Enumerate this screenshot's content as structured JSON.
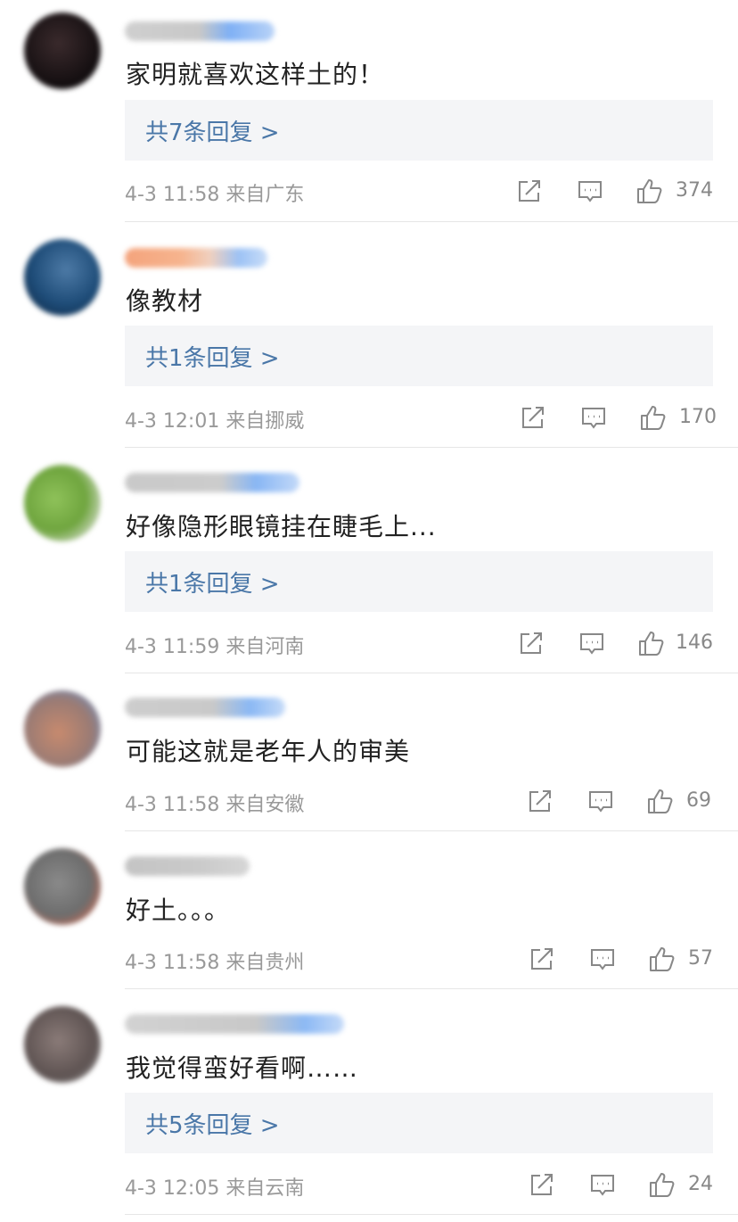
{
  "comments": [
    {
      "text": "家明就喜欢这样土的！",
      "replies": "共7条回复 >",
      "time": "4-3 11:58",
      "location": "来自广东",
      "likes": "374"
    },
    {
      "text": "像教材",
      "replies": "共1条回复 >",
      "time": "4-3 12:01",
      "location": "来自挪威",
      "likes": "170"
    },
    {
      "text": "好像隐形眼镜挂在睫毛上...",
      "replies": "共1条回复 >",
      "time": "4-3 11:59",
      "location": "来自河南",
      "likes": "146"
    },
    {
      "text": "可能这就是老年人的审美",
      "time": "4-3 11:58",
      "location": "来自安徽",
      "likes": "69"
    },
    {
      "text": "好土。。。",
      "time": "4-3 11:58",
      "location": "来自贵州",
      "likes": "57"
    },
    {
      "text": "我觉得蛮好看啊……",
      "replies": "共5条回复 >",
      "time": "4-3 12:05",
      "location": "来自云南",
      "likes": "24"
    }
  ],
  "colors": {
    "reply_link": "#4a77a8",
    "meta": "#999999",
    "reply_bg": "#f4f5f7"
  },
  "icons": [
    "share-icon",
    "comment-icon",
    "like-icon"
  ]
}
